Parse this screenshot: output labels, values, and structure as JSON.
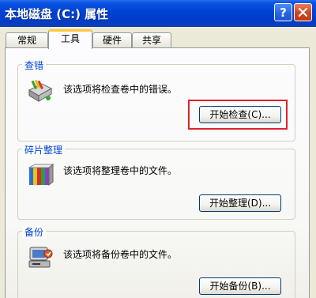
{
  "window": {
    "title": "本地磁盘 (C:) 属性",
    "help_label": "?",
    "close_label": "关闭"
  },
  "tabs": [
    {
      "label": "常规",
      "active": false
    },
    {
      "label": "工具",
      "active": true
    },
    {
      "label": "硬件",
      "active": false
    },
    {
      "label": "共享",
      "active": false
    }
  ],
  "groups": {
    "check": {
      "title": "查错",
      "description": "该选项将检查卷中的错误。",
      "button_label": "开始检查(C)...",
      "icon": "disk-check-icon"
    },
    "defrag": {
      "title": "碎片整理",
      "description": "该选项将整理卷中的文件。",
      "button_label": "开始整理(D)...",
      "icon": "defrag-icon"
    },
    "backup": {
      "title": "备份",
      "description": "该选项将备份卷中的文件。",
      "button_label": "开始备份(B)...",
      "icon": "backup-icon"
    }
  },
  "colors": {
    "titlebar": "#0042d4",
    "group_title": "#0046d5",
    "highlight": "#e0232e",
    "tab_active_accent": "#ffc83c"
  }
}
